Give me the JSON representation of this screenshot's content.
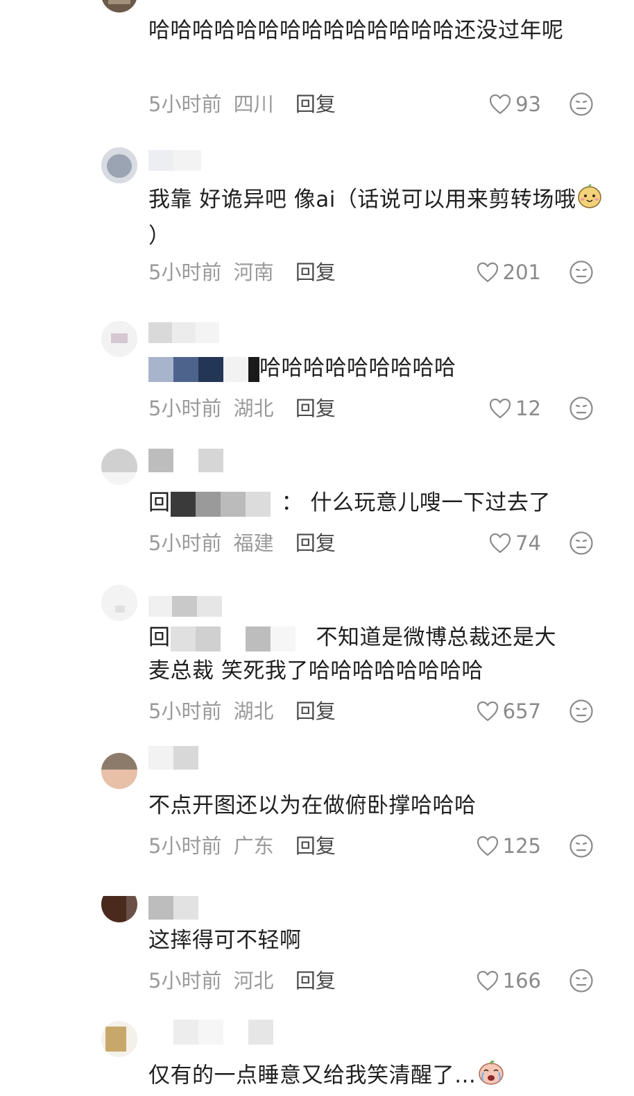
{
  "comments": [
    {
      "text": "哈哈哈哈哈哈哈哈哈哈哈哈哈哈还没过年呢",
      "time": "5小时前",
      "location": "四川",
      "reply": "回复",
      "likes": "93"
    },
    {
      "text": "我靠 好诡异吧 像ai（话说可以用来剪转场哦",
      "text_end": "）",
      "time": "5小时前",
      "location": "河南",
      "reply": "回复",
      "likes": "201"
    },
    {
      "text": "哈哈哈哈哈哈哈哈哈",
      "time": "5小时前",
      "location": "湖北",
      "reply": "回复",
      "likes": "12"
    },
    {
      "prefix": "回",
      "text": "：  什么玩意儿嗖一下过去了",
      "time": "5小时前",
      "location": "福建",
      "reply": "回复",
      "likes": "74"
    },
    {
      "prefix": "回",
      "text": "不知道是微博总裁还是大",
      "text_line2": "麦总裁 笑死我了哈哈哈哈哈哈哈哈",
      "time": "5小时前",
      "location": "湖北",
      "reply": "回复",
      "likes": "657"
    },
    {
      "text": "不点开图还以为在做俯卧撑哈哈哈",
      "time": "5小时前",
      "location": "广东",
      "reply": "回复",
      "likes": "125"
    },
    {
      "text": "这摔得可不轻啊",
      "time": "5小时前",
      "location": "河北",
      "reply": "回复",
      "likes": "166"
    },
    {
      "text": "仅有的一点睡意又给我笑清醒了…"
    }
  ],
  "icons": {
    "like": "heart-outline-icon",
    "dislike": "neutral-face-icon",
    "emoji_1": "smiling-potato-emoji",
    "emoji_2": "crying-laughing-emoji"
  },
  "colors": {
    "text": "#1f1f1f",
    "meta": "#9a9a9a",
    "reply": "#4a4a4a"
  }
}
